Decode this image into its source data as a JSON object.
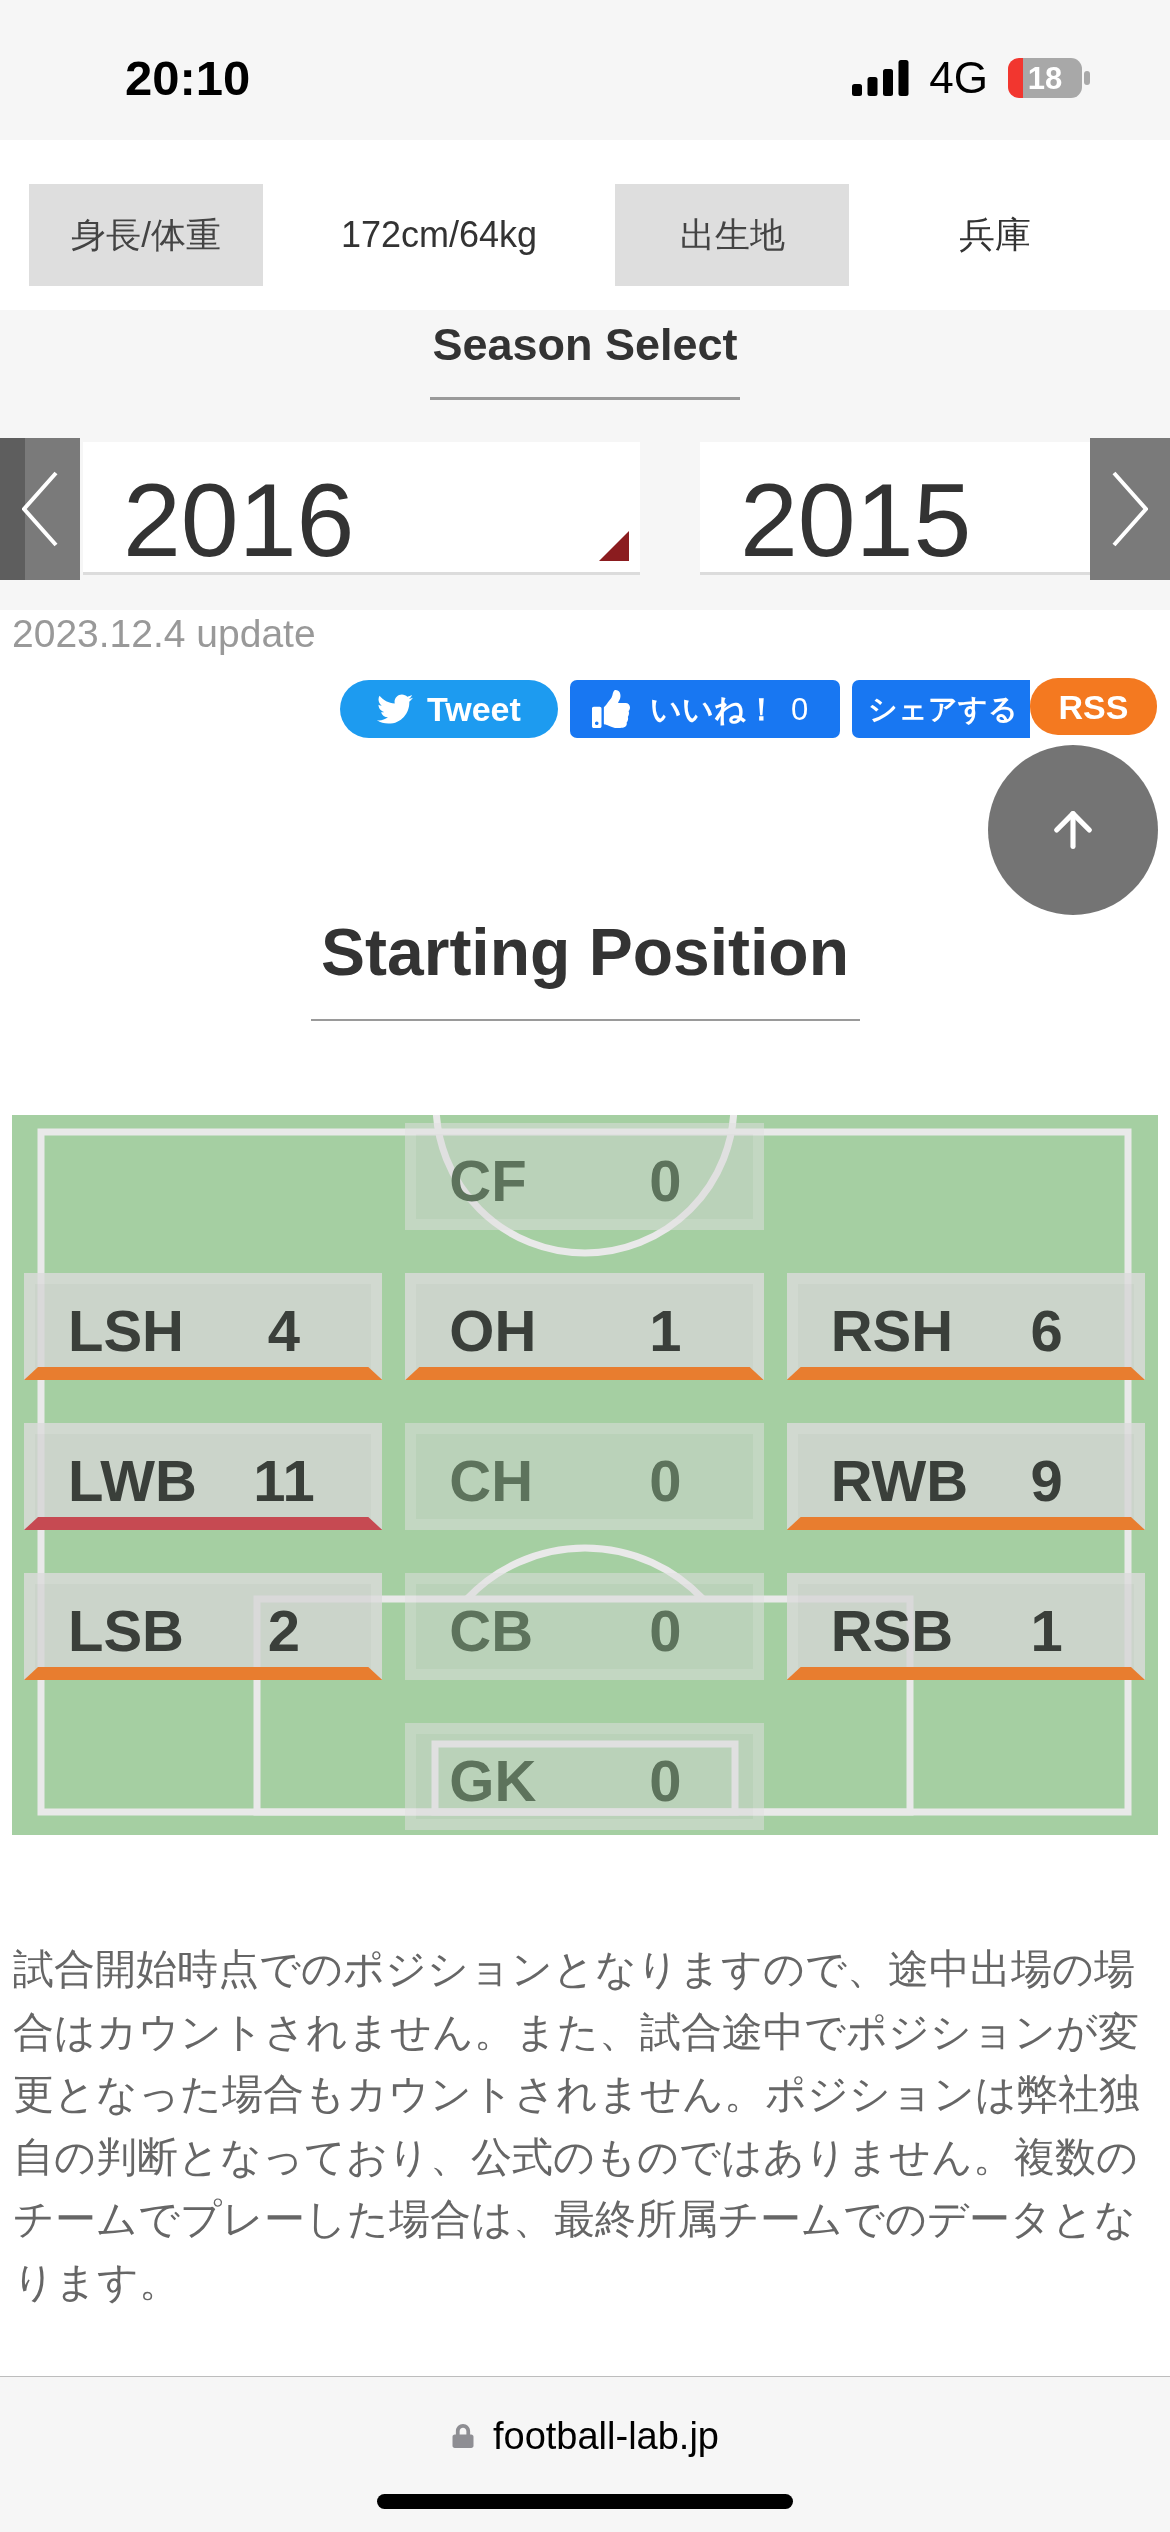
{
  "status_bar": {
    "time": "20:10",
    "network": "4G",
    "battery": "18"
  },
  "profile": [
    {
      "label": "身長/体重",
      "value": "172cm/64kg"
    },
    {
      "label": "出生地",
      "value": "兵庫"
    }
  ],
  "season_select": {
    "title": "Season Select",
    "seasons": [
      {
        "year": "2016",
        "selected": true
      },
      {
        "year": "2015",
        "selected": false
      }
    ]
  },
  "update_note": "2023.12.4 update",
  "share_buttons": [
    {
      "kind": "tweet",
      "label": "Tweet"
    },
    {
      "kind": "like",
      "label": "いいね！",
      "count": "0"
    },
    {
      "kind": "share",
      "label": "シェアする"
    },
    {
      "kind": "rss",
      "label": "RSS"
    }
  ],
  "starting_position": {
    "title": "Starting Position",
    "rows": [
      {
        "positions": [
          {
            "label": "CF",
            "count": "0",
            "active": false
          }
        ]
      },
      {
        "positions": [
          {
            "label": "LSH",
            "count": "4",
            "active": true,
            "color": "#e87d2f"
          },
          {
            "label": "OH",
            "count": "1",
            "active": true,
            "color": "#e87d2f"
          },
          {
            "label": "RSH",
            "count": "6",
            "active": true,
            "color": "#e87d2f"
          }
        ]
      },
      {
        "positions": [
          {
            "label": "LWB",
            "count": "11",
            "active": true,
            "color": "#c64a52"
          },
          {
            "label": "CH",
            "count": "0",
            "active": false
          },
          {
            "label": "RWB",
            "count": "9",
            "active": true,
            "color": "#e87d2f"
          }
        ]
      },
      {
        "positions": [
          {
            "label": "LSB",
            "count": "2",
            "active": true,
            "color": "#e87d2f"
          },
          {
            "label": "CB",
            "count": "0",
            "active": false
          },
          {
            "label": "RSB",
            "count": "1",
            "active": true,
            "color": "#e87d2f"
          }
        ]
      },
      {
        "positions": [
          {
            "label": "GK",
            "count": "0",
            "active": false
          }
        ]
      }
    ]
  },
  "note": "試合開始時点でのポジションとなりますので、途中出場の場合はカウントされません。また、試合途中でポジションが変更となった場合もカウントされません。ポジションは弊社独自の判断となっており、公式のものではありません。複数のチームでプレーした場合は、最終所属チームでのデータとなります。",
  "browser_bar": {
    "url": "football-lab.jp"
  }
}
